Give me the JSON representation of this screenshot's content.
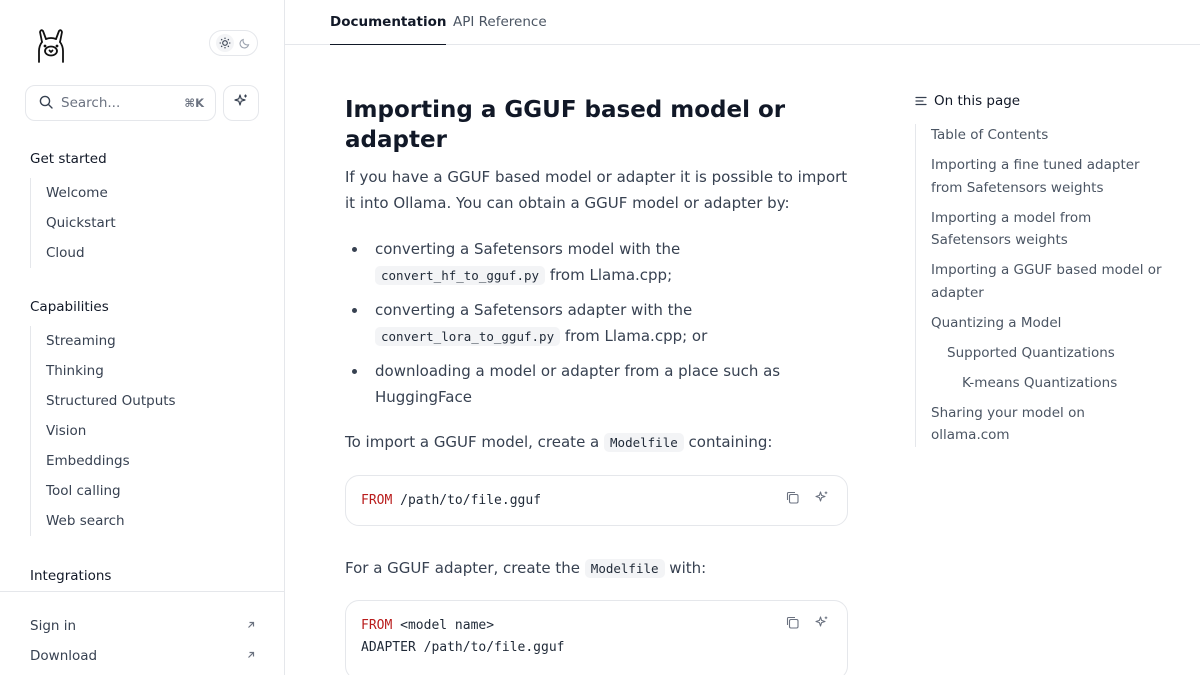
{
  "theme_toggle": {
    "light_icon": "sun-icon",
    "dark_icon": "moon-icon"
  },
  "search": {
    "placeholder": "Search...",
    "shortcut": "⌘K"
  },
  "sidebar": {
    "groups": [
      {
        "title": "Get started",
        "items": [
          "Welcome",
          "Quickstart",
          "Cloud"
        ]
      },
      {
        "title": "Capabilities",
        "items": [
          "Streaming",
          "Thinking",
          "Structured Outputs",
          "Vision",
          "Embeddings",
          "Tool calling",
          "Web search"
        ]
      },
      {
        "title": "Integrations",
        "items": []
      }
    ],
    "footer": [
      {
        "label": "Sign in"
      },
      {
        "label": "Download"
      }
    ]
  },
  "topbar": {
    "tabs": [
      {
        "label": "Documentation",
        "active": true
      },
      {
        "label": "API Reference",
        "active": false
      }
    ]
  },
  "article": {
    "heading": "Importing a GGUF based model or adapter",
    "intro": "If you have a GGUF based model or adapter it is possible to import it into Ollama. You can obtain a GGUF model or adapter by:",
    "bullets": [
      {
        "pre": "converting a Safetensors model with the ",
        "code": "convert_hf_to_gguf.py",
        "post": " from Llama.cpp;"
      },
      {
        "pre": "converting a Safetensors adapter with the ",
        "code": "convert_lora_to_gguf.py",
        "post": " from Llama.cpp; or"
      },
      {
        "pre": "downloading a model or adapter from a place such as HuggingFace",
        "code": "",
        "post": ""
      }
    ],
    "p2_pre": "To import a GGUF model, create a ",
    "p2_code": "Modelfile",
    "p2_post": " containing:",
    "code1": {
      "kw": "FROM",
      "rest": " /path/to/file.gguf"
    },
    "p3_pre": "For a GGUF adapter, create the ",
    "p3_code": "Modelfile",
    "p3_post": " with:",
    "code2": {
      "line1_kw": "FROM",
      "line1_rest": " <model name>",
      "line2": "ADAPTER /path/to/file.gguf"
    }
  },
  "toc": {
    "title": "On this page",
    "items": [
      {
        "label": "Table of Contents",
        "level": 1
      },
      {
        "label": "Importing a fine tuned adapter from Safetensors weights",
        "level": 1
      },
      {
        "label": "Importing a model from Safetensors weights",
        "level": 1
      },
      {
        "label": "Importing a GGUF based model or adapter",
        "level": 1
      },
      {
        "label": "Quantizing a Model",
        "level": 1
      },
      {
        "label": "Supported Quantizations",
        "level": 2
      },
      {
        "label": "K-means Quantizations",
        "level": 3
      },
      {
        "label": "Sharing your model on ollama.com",
        "level": 1
      }
    ]
  }
}
